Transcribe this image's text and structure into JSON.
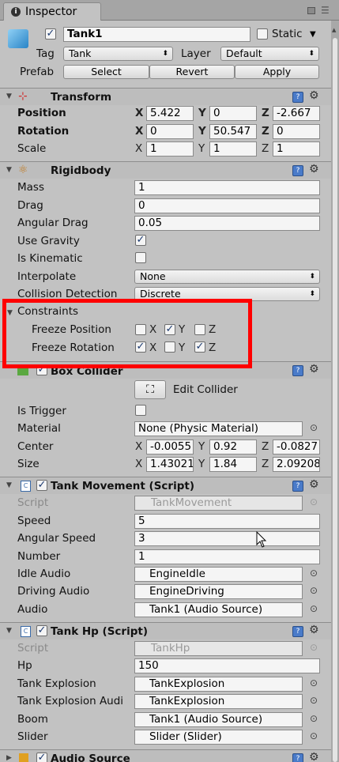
{
  "tab": {
    "title": "Inspector"
  },
  "object": {
    "name": "Tank1",
    "active": true,
    "static_label": "Static",
    "static_checked": false,
    "tag_label": "Tag",
    "tag_value": "Tank",
    "layer_label": "Layer",
    "layer_value": "Default",
    "prefab_label": "Prefab",
    "select": "Select",
    "revert": "Revert",
    "apply": "Apply"
  },
  "transform": {
    "title": "Transform",
    "position_label": "Position",
    "rotation_label": "Rotation",
    "scale_label": "Scale",
    "px": "5.422",
    "py": "0",
    "pz": "-2.667",
    "rx": "0",
    "ry": "50.547",
    "rz": "0",
    "sx": "1",
    "sy": "1",
    "sz": "1"
  },
  "axes": {
    "x": "X",
    "y": "Y",
    "z": "Z"
  },
  "rigidbody": {
    "title": "Rigidbody",
    "mass_label": "Mass",
    "mass": "1",
    "drag_label": "Drag",
    "drag": "0",
    "angdrag_label": "Angular Drag",
    "angdrag": "0.05",
    "gravity_label": "Use Gravity",
    "gravity": true,
    "kinematic_label": "Is Kinematic",
    "kinematic": false,
    "interp_label": "Interpolate",
    "interp": "None",
    "coll_label": "Collision Detection",
    "coll": "Discrete",
    "constraints_label": "Constraints",
    "freezepos_label": "Freeze Position",
    "freezerot_label": "Freeze Rotation",
    "freeze_position": {
      "x": false,
      "y": true,
      "z": false
    },
    "freeze_rotation": {
      "x": true,
      "y": false,
      "z": true
    }
  },
  "box_collider": {
    "title": "Box Collider",
    "edit": "Edit Collider",
    "trigger_label": "Is Trigger",
    "trigger": false,
    "material_label": "Material",
    "material": "None (Physic Material)",
    "center_label": "Center",
    "size_label": "Size",
    "cx": "-0.0055",
    "cy": "0.92",
    "cz": "-0.0827",
    "sx": "1.43021",
    "sy": "1.84",
    "sz": "2.09208"
  },
  "tank_movement": {
    "title": "Tank Movement (Script)",
    "script_label": "Script",
    "script": "TankMovement",
    "speed_label": "Speed",
    "speed": "5",
    "angspeed_label": "Angular Speed",
    "angspeed": "3",
    "number_label": "Number",
    "number": "1",
    "idle_label": "Idle Audio",
    "idle": "EngineIdle",
    "driving_label": "Driving Audio",
    "driving": "EngineDriving",
    "audio_label": "Audio",
    "audio": "Tank1 (Audio Source)"
  },
  "tank_hp": {
    "title": "Tank Hp (Script)",
    "script_label": "Script",
    "script": "TankHp",
    "hp_label": "Hp",
    "hp": "150",
    "explosion_label": "Tank Explosion",
    "explosion": "TankExplosion",
    "explosion_audio_label": "Tank Explosion Audi",
    "explosion_audio": "TankExplosion",
    "boom_label": "Boom",
    "boom": "Tank1 (Audio Source)",
    "slider_label": "Slider",
    "slider": "Slider (Slider)"
  },
  "audio_source": {
    "title": "Audio Source"
  },
  "colors": {
    "highlight": "#ff0000",
    "panel": "#c2c2c2"
  }
}
